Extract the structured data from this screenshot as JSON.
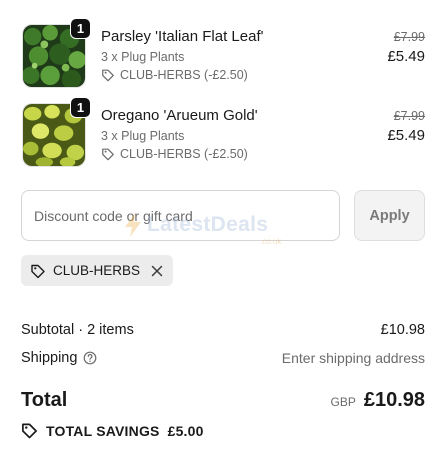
{
  "items": [
    {
      "quantity": "1",
      "title": "Parsley 'Italian Flat Leaf'",
      "variant": "3 x Plug Plants",
      "discount": "CLUB-HERBS (-£2.50)",
      "original_price": "£7.99",
      "price": "£5.49",
      "thumb_icon": "parsley-plant-image"
    },
    {
      "quantity": "1",
      "title": "Oregano 'Arueum Gold'",
      "variant": "3 x Plug Plants",
      "discount": "CLUB-HERBS (-£2.50)",
      "original_price": "£7.99",
      "price": "£5.49",
      "thumb_icon": "oregano-plant-image"
    }
  ],
  "discount_form": {
    "placeholder": "Discount code or gift card",
    "value": "",
    "apply_label": "Apply"
  },
  "watermark": {
    "text": "LatestDeals",
    "sub": ".co.uk"
  },
  "applied_code": {
    "label": "CLUB-HERBS",
    "icon": "tag-icon",
    "remove_icon": "close-icon"
  },
  "summary": {
    "subtotal_label": "Subtotal · 2 items",
    "subtotal_value": "£10.98",
    "shipping_label": "Shipping",
    "shipping_value": "Enter shipping address",
    "total_label": "Total",
    "currency": "GBP",
    "total_value": "£10.98",
    "savings_label": "TOTAL SAVINGS",
    "savings_value": "£5.00"
  },
  "colors": {
    "badge": "#111111",
    "muted_text": "#6b6b6b",
    "chip_bg": "#ececec",
    "apply_bg": "#f3f3f3"
  }
}
